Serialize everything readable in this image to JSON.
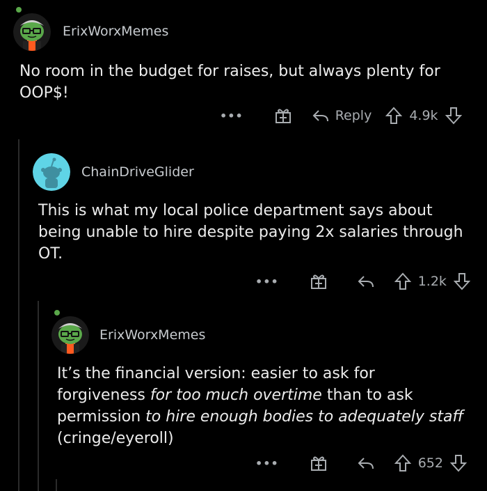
{
  "colors": {
    "background": "#000000",
    "text": "#ececec",
    "muted": "#a9adb1",
    "snoo_cyan": "#5fd4e6",
    "avatar_green": "#5aa84a",
    "shirt_orange": "#ff5a1f"
  },
  "comments": [
    {
      "username": "ErixWorxMemes",
      "text": "No room in the budget for raises, but always plenty for OOP$!",
      "reply_label": "Reply",
      "score": "4.9k",
      "avatar_icon": "snoo-glasses-avatar-icon"
    },
    {
      "username": "ChainDriveGlider",
      "text": "This is what my local police department says about being unable to hire despite paying 2x salaries through OT.",
      "score": "1.2k",
      "avatar_icon": "snoo-default-avatar-icon"
    },
    {
      "username": "ErixWorxMemes",
      "text_parts": [
        "It’s the financial version: easier to ask for forgiveness ",
        "for too much overtime",
        " than to ask permission ",
        "to hire enough bodies to adequately staff",
        " (cringe/eyeroll)"
      ],
      "score": "652",
      "avatar_icon": "snoo-glasses-avatar-icon"
    }
  ],
  "action_icons": [
    "more-options-icon",
    "award-gift-icon",
    "reply-arrow-icon",
    "upvote-icon",
    "downvote-icon"
  ],
  "more_label": "•••"
}
